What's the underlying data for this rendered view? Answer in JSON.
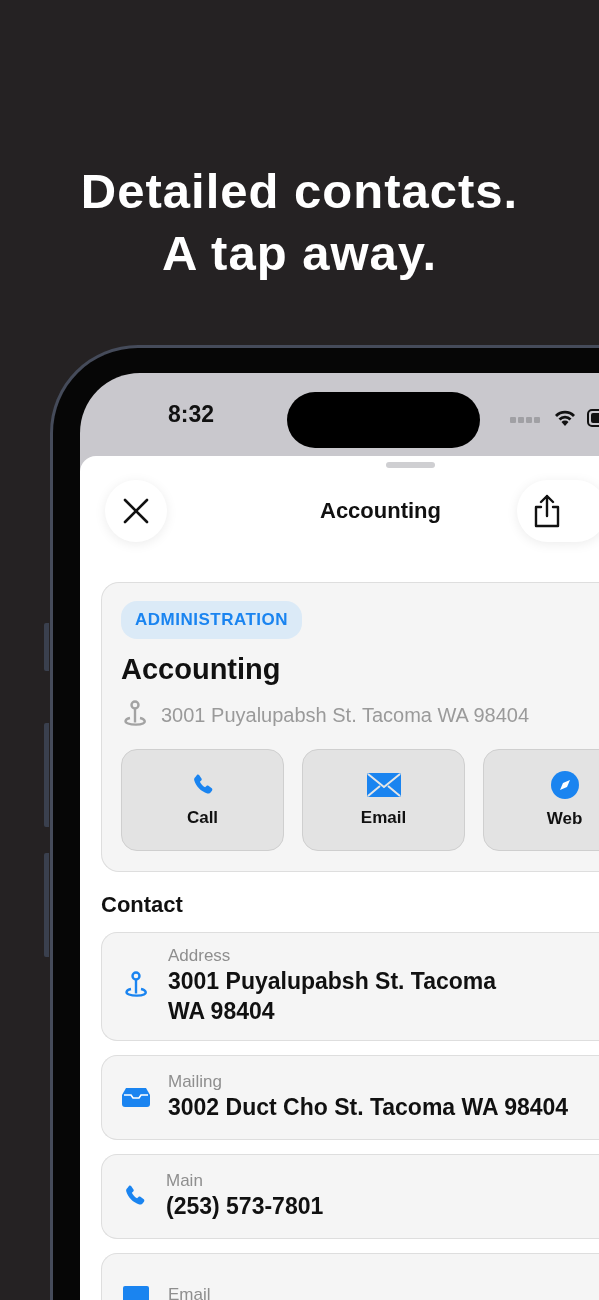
{
  "headline": "Detailed contacts. A tap away.",
  "status_bar": {
    "time": "8:32"
  },
  "sheet": {
    "title": "Accounting"
  },
  "card": {
    "tag": "ADMINISTRATION",
    "name": "Accounting",
    "address": "3001 Puyalupabsh St. Tacoma WA 98404",
    "actions": [
      {
        "label": "Call",
        "kind": "phone"
      },
      {
        "label": "Email",
        "kind": "mail"
      },
      {
        "label": "Web",
        "kind": "compass"
      }
    ]
  },
  "contact": {
    "title": "Contact",
    "rows": [
      {
        "label": "Address",
        "value": "3001 Puyalupabsh St. Tacoma\nWA 98404",
        "kind": "location"
      },
      {
        "label": "Mailing",
        "value": "3002 Duct Cho St. Tacoma WA 98404",
        "kind": "tray"
      },
      {
        "label": "Main",
        "value": "(253) 573-7801",
        "kind": "phone"
      },
      {
        "label": "Email",
        "kind": "email"
      }
    ]
  }
}
